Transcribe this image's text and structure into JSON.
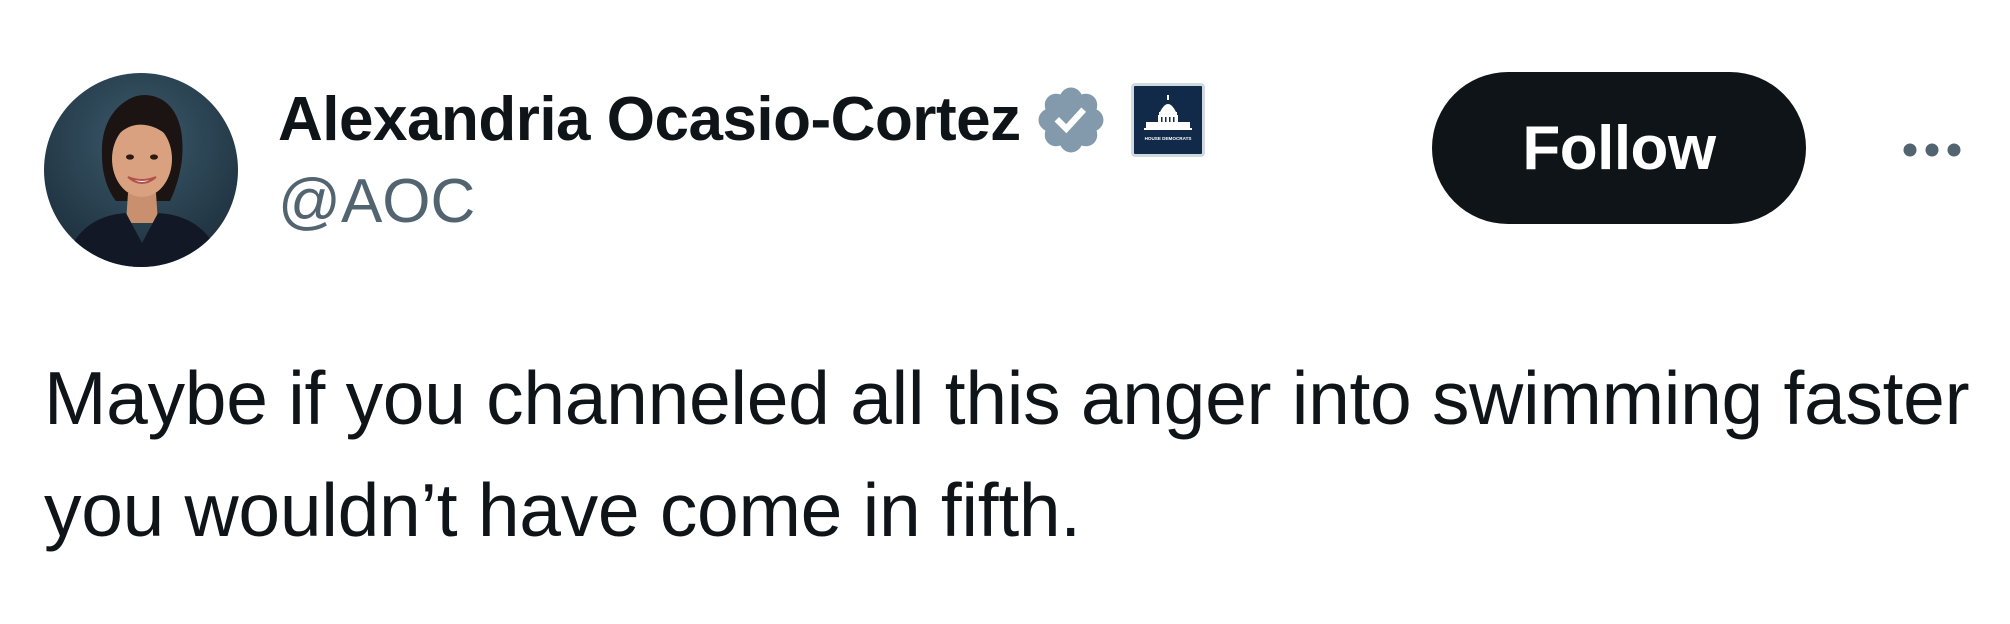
{
  "tweet": {
    "author": {
      "display_name": "Alexandria Ocasio-Cortez",
      "handle": "@AOC",
      "verified_badge_icon": "verified-check-icon",
      "verified_badge_color": "#829aab",
      "affiliate_badge_icon": "capitol-building-icon",
      "affiliate_badge_text": "HOUSE DEMOCRATS",
      "affiliate_badge_color": "#112a4a"
    },
    "follow_button": {
      "label": "Follow",
      "background": "#0f1419",
      "text_color": "#ffffff"
    },
    "more_button": {
      "icon": "more-horizontal-icon"
    },
    "text": "Maybe if you channeled all this anger into swimming faster you wouldn’t have come in fifth."
  }
}
